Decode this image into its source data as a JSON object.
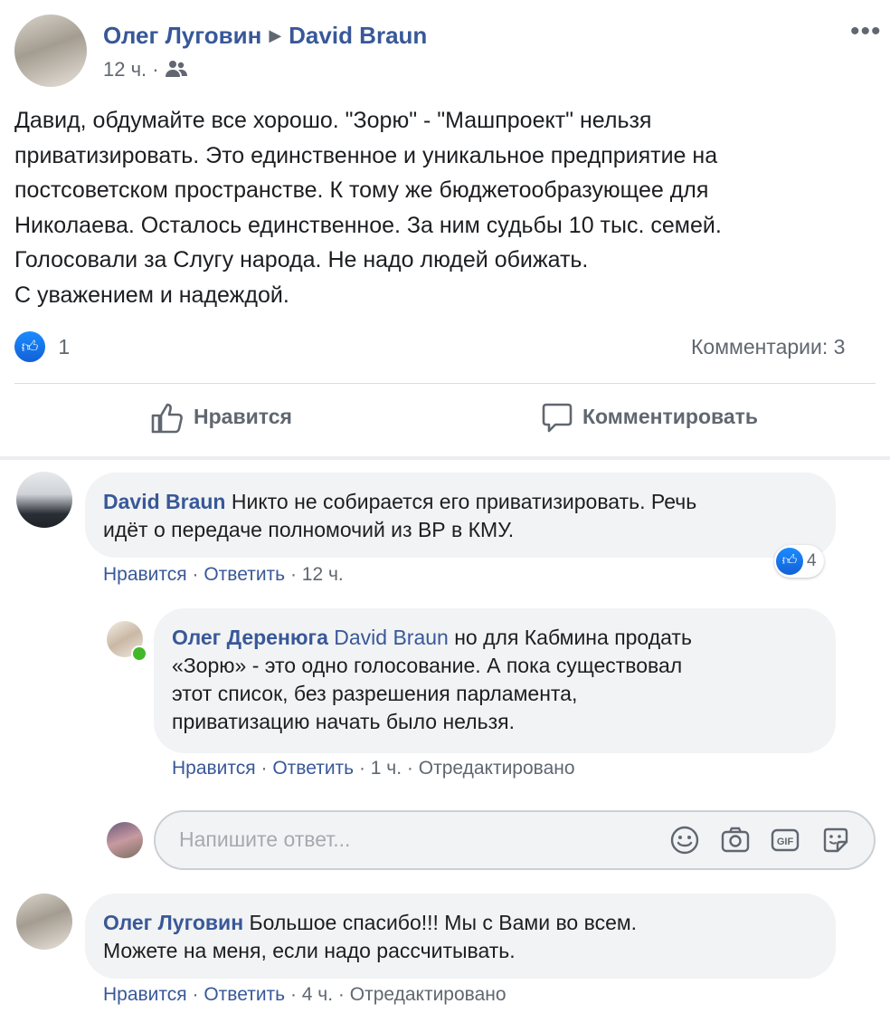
{
  "post": {
    "author": "Олег Луговин",
    "target": "David Braun",
    "time": "12 ч.",
    "dot": "·",
    "text_lines": [
      "Давид, обдумайте все хорошо. \"Зорю\" - \"Машпроект\" нельзя",
      "приватизировать. Это единственное и уникальное предприятие на",
      "постсоветском пространстве. К тому же бюджетообразующее для",
      "Николаева. Осталось единственное. За ним судьбы 10 тыс. семей.",
      "Голосовали за Слугу народа. Не надо людей обижать.",
      "С уважением и надеждой."
    ],
    "likes_count": "1",
    "comments_count": "Комментарии: 3",
    "like_label": "Нравится",
    "comment_label": "Комментировать"
  },
  "comments": [
    {
      "author": "David Braun",
      "lines": [
        "Никто не собирается его приватизировать. Речь",
        "идёт о передаче полномочий из ВР в КМУ."
      ],
      "reaction_count": "4",
      "like": "Нравится",
      "reply": "Ответить",
      "time": "12 ч.",
      "sep": " · "
    },
    {
      "author": "Олег Деренюга",
      "mention": "David Braun",
      "first_line_rest": "но для Кабмина продать",
      "lines": [
        "«Зорю» - это одно голосование. А пока существовал",
        "этот список, без разрешения парламента,",
        "приватизацию начать было нельзя."
      ],
      "like": "Нравится",
      "reply": "Ответить",
      "time": "1 ч.",
      "edited": "Отредактировано",
      "sep": " · "
    },
    {
      "author": "Олег Луговин",
      "first_line_rest": "Большое спасибо!!! Мы с Вами во всем.",
      "lines": [
        "Можете на меня, если надо рассчитывать."
      ],
      "like": "Нравится",
      "reply": "Ответить",
      "time": "4 ч.",
      "edited": "Отредактировано",
      "sep": " · "
    }
  ],
  "reply_box": {
    "placeholder": "Напишите ответ..."
  },
  "icons": {
    "audience": "friends-icon",
    "like_badge": "thumbs-up-icon",
    "emoji": "smiley-icon",
    "camera": "camera-icon",
    "gif": "gif-icon",
    "sticker": "sticker-icon",
    "more": "more-icon"
  },
  "colors": {
    "link": "#385898",
    "muted": "#606770",
    "like_blue": "#1877f2",
    "bubble": "#f2f3f5"
  }
}
